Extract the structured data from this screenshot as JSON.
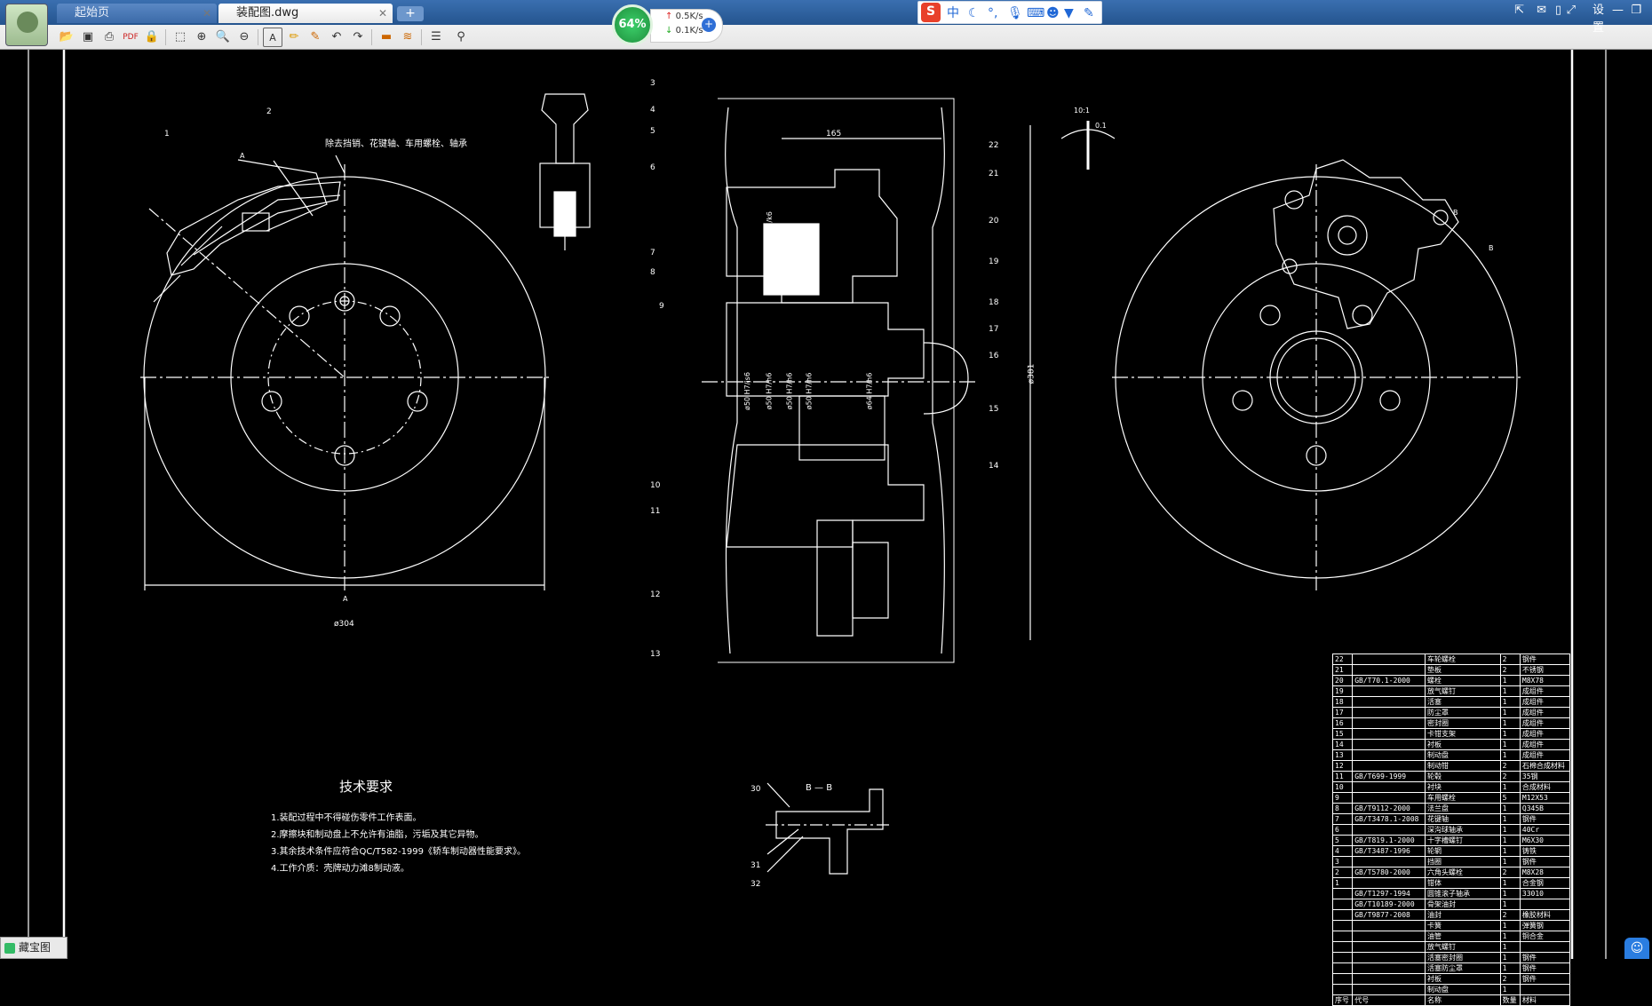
{
  "app": {
    "tabs": [
      {
        "label": "起始页",
        "active": false
      },
      {
        "label": "装配图.dwg",
        "active": true
      }
    ],
    "new_tab_label": "+",
    "network": {
      "percent": "64%",
      "up": "0.5K/s",
      "down": "0.1K/s"
    },
    "ime": {
      "logo": "S",
      "mode": "中",
      "icons": [
        "moon-icon",
        "dot-icon",
        "mic-icon",
        "keyboard-icon",
        "user-icon",
        "shirt-icon",
        "wrench-icon"
      ]
    },
    "window": {
      "settings_label": "设置"
    },
    "status": {
      "label": "藏宝图"
    }
  },
  "toolbar": {
    "buttons": [
      "open-icon",
      "save-icon",
      "print-icon",
      "pdf-icon",
      "lock-icon",
      "select-icon",
      "zoom-in-icon",
      "zoom-window-icon",
      "zoom-out-icon",
      "text-icon",
      "pencil-icon",
      "markup-icon",
      "undo-icon",
      "redo-icon",
      "measure-icon",
      "measure-multi-icon",
      "layers-icon",
      "stamp-icon"
    ]
  },
  "drawing": {
    "note_top": "除去挡销、花键轴、车用螺栓、轴承",
    "tech_title": "技术要求",
    "tech_items": [
      "1.装配过程中不得碰伤零件工作表面。",
      "2.摩擦块和制动盘上不允许有油脂，污垢及其它异物。",
      "3.其余技术条件应符合QC/T582-1999《轿车制动器性能要求》。",
      "4.工作介质：壳牌动力滩8制动液。"
    ],
    "section_label": "B — B",
    "dim_left_dia": "ø304",
    "dim_top": "165",
    "dim_right_dia": "ø381",
    "dim_small_a": "10:1",
    "dim_small_b": "0.1",
    "view_marks": [
      "A",
      "A",
      "B",
      "B"
    ],
    "balloons_left": [
      "1",
      "2"
    ],
    "balloons_mid": [
      "3",
      "4",
      "5",
      "6",
      "7",
      "8",
      "9",
      "10",
      "11",
      "12",
      "13",
      "14",
      "15",
      "16",
      "17",
      "18",
      "19",
      "20",
      "21",
      "22"
    ],
    "balloons_section": [
      "30",
      "31",
      "32"
    ],
    "fit_labels": [
      "ø50H7/k6",
      "ø50 H7/js6",
      "ø50 H7/h6",
      "ø50 H7/h6",
      "ø50 H7/h6",
      "ø64 H7/h6"
    ],
    "bom_rows": [
      [
        "22",
        "",
        "车轮螺栓",
        "2",
        "钢件"
      ],
      [
        "21",
        "",
        "垫板",
        "2",
        "不锈钢"
      ],
      [
        "20",
        "GB/T70.1-2000",
        "螺栓",
        "1",
        "M8X78"
      ],
      [
        "19",
        "",
        "放气螺钉",
        "1",
        "成组件"
      ],
      [
        "18",
        "",
        "活塞",
        "1",
        "成组件"
      ],
      [
        "17",
        "",
        "防尘罩",
        "1",
        "成组件"
      ],
      [
        "16",
        "",
        "密封圈",
        "1",
        "成组件"
      ],
      [
        "15",
        "",
        "卡钳支架",
        "1",
        "成组件"
      ],
      [
        "14",
        "",
        "衬板",
        "1",
        "成组件"
      ],
      [
        "13",
        "",
        "制动盘",
        "1",
        "成组件"
      ],
      [
        "12",
        "",
        "制动钳",
        "2",
        "石棉合成材料"
      ],
      [
        "11",
        "GB/T699-1999",
        "轮毂",
        "2",
        "35钢"
      ],
      [
        "10",
        "",
        "衬块",
        "1",
        "合成材料"
      ],
      [
        "9",
        "",
        "车用螺栓",
        "5",
        "M12X53"
      ],
      [
        "8",
        "GB/T9112-2000",
        "法兰盘",
        "1",
        "Q345B"
      ],
      [
        "7",
        "GB/T3478.1-2008",
        "花键轴",
        "1",
        "钢件"
      ],
      [
        "6",
        "",
        "深沟球轴承",
        "1",
        "40Cr"
      ],
      [
        "5",
        "GB/T819.1-2000",
        "十字槽螺钉",
        "1",
        "M6X30"
      ],
      [
        "4",
        "GB/T3487-1996",
        "轮辋",
        "1",
        "铸铁"
      ],
      [
        "3",
        "",
        "挡圈",
        "1",
        "钢件"
      ],
      [
        "2",
        "GB/T5780-2000",
        "六角头螺栓",
        "2",
        "M8X28"
      ],
      [
        "1",
        "",
        "钳体",
        "1",
        "合金钢"
      ],
      [
        "",
        "GB/T1297-1994",
        "圆锥滚子轴承",
        "1",
        "33010"
      ],
      [
        "",
        "GB/T10189-2000",
        "骨架油封",
        "1",
        ""
      ],
      [
        "",
        "GB/T9877-2008",
        "油封",
        "2",
        "橡胶材料"
      ],
      [
        "",
        "",
        "卡簧",
        "1",
        "弹簧钢"
      ],
      [
        "",
        "",
        "油管",
        "1",
        "铜合金"
      ],
      [
        "",
        "",
        "放气螺钉",
        "1",
        ""
      ],
      [
        "",
        "",
        "活塞密封圈",
        "1",
        "钢件"
      ],
      [
        "",
        "",
        "活塞防尘罩",
        "1",
        "钢件"
      ],
      [
        "",
        "",
        "衬板",
        "2",
        "钢件"
      ],
      [
        "",
        "",
        "制动盘",
        "1",
        ""
      ]
    ],
    "bom_header": [
      "序号",
      "代号",
      "名称",
      "数量",
      "材料",
      "备注"
    ]
  }
}
